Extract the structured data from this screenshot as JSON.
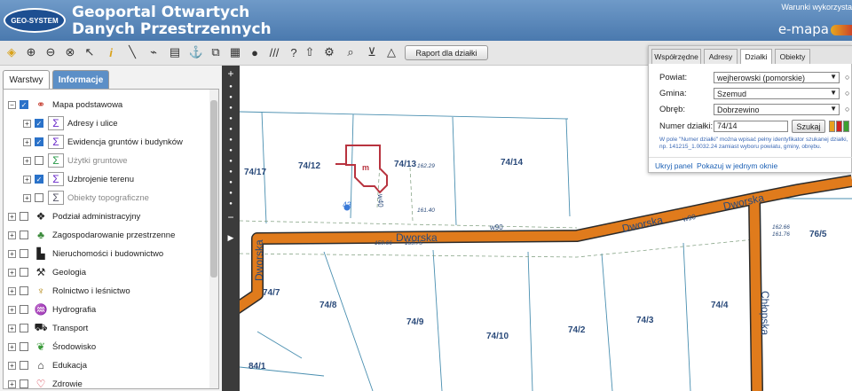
{
  "header": {
    "logo": "GEO-SYSTEM",
    "title_line1": "Geoportal Otwartych",
    "title_line2": "Danych Przestrzennych",
    "terms_link": "Warunki wykorzysta",
    "brand": "e-mapa"
  },
  "toolbar": {
    "report_button": "Raport dla działki",
    "icons": [
      "layers-icon",
      "zoom-in-icon",
      "zoom-out-icon",
      "pointer-icon",
      "info-icon",
      "measure-line-icon",
      "measure-area-icon",
      "print-icon",
      "anchor-icon",
      "copy-icon",
      "layout-icon",
      "speech-icon",
      "hatch-icon",
      "help-icon",
      "route-icon",
      "gear-icon",
      "search-zoom-icon",
      "cart-icon",
      "warning-icon"
    ]
  },
  "left_panel": {
    "tabs": [
      "Warstwy",
      "Informacje"
    ],
    "layers": [
      {
        "label": "Mapa podstawowa",
        "expanded": true,
        "checked": true,
        "level": 0,
        "icon": "base-map-icon"
      },
      {
        "label": "Adresy i ulice",
        "checked": true,
        "level": 1,
        "icon": "address-icon"
      },
      {
        "label": "Ewidencja gruntów i budynków",
        "checked": true,
        "level": 1,
        "icon": "cadastre-icon"
      },
      {
        "label": "Użytki gruntowe",
        "checked": false,
        "level": 1,
        "icon": "land-use-icon"
      },
      {
        "label": "Uzbrojenie terenu",
        "checked": true,
        "level": 1,
        "icon": "utilities-icon"
      },
      {
        "label": "Obiekty topograficzne",
        "checked": false,
        "level": 1,
        "icon": "topo-icon"
      },
      {
        "label": "Podział administracyjny",
        "checked": false,
        "level": 0,
        "icon": "admin-icon"
      },
      {
        "label": "Zagospodarowanie przestrzenne",
        "checked": false,
        "level": 0,
        "icon": "zoning-icon"
      },
      {
        "label": "Nieruchomości i budownictwo",
        "checked": false,
        "level": 0,
        "icon": "building-icon"
      },
      {
        "label": "Geologia",
        "checked": false,
        "level": 0,
        "icon": "geology-icon"
      },
      {
        "label": "Rolnictwo i leśnictwo",
        "checked": false,
        "level": 0,
        "icon": "agriculture-icon"
      },
      {
        "label": "Hydrografia",
        "checked": false,
        "level": 0,
        "icon": "water-icon"
      },
      {
        "label": "Transport",
        "checked": false,
        "level": 0,
        "icon": "transport-icon"
      },
      {
        "label": "Środowisko",
        "checked": false,
        "level": 0,
        "icon": "leaf-icon"
      },
      {
        "label": "Edukacja",
        "checked": false,
        "level": 0,
        "icon": "education-icon"
      },
      {
        "label": "Zdrowie",
        "checked": false,
        "level": 0,
        "icon": "health-icon"
      }
    ]
  },
  "dialog": {
    "tabs": [
      "Współrzędne",
      "Adresy",
      "Działki",
      "Obiekty"
    ],
    "active_tab": "Działki",
    "powiat_label": "Powiat:",
    "powiat_value": "wejherowski (pomorskie)",
    "gmina_label": "Gmina:",
    "gmina_value": "Szemud",
    "obreb_label": "Obręb:",
    "obreb_value": "Dobrzewino",
    "numer_label": "Numer działki:",
    "numer_value": "74/14",
    "search_button": "Szukaj",
    "hint": "W pole \"Numer działki\" można wpisać pełny identyfikator szukanej działki, np. 141215_1.0032.24 zamiast wyboru powiatu, gminy, obrębu.",
    "hide_link": "Ukryj panel",
    "show_link": "Pokazuj w jednym oknie"
  },
  "map": {
    "parcels": [
      "74/17",
      "74/12",
      "74/13",
      "74/14",
      "74/7",
      "74/8",
      "74/9",
      "74/10",
      "74/2",
      "74/3",
      "74/4",
      "76/5",
      "84/1"
    ],
    "streets": [
      "Dworska",
      "Dworska",
      "Dworska",
      "Dworska",
      "Chłopska"
    ],
    "annotations": [
      "w90",
      "w90",
      "w40",
      "43",
      "m",
      "162.29",
      "161.40",
      "159.66",
      "159.75",
      "162.66",
      "161.76"
    ]
  }
}
